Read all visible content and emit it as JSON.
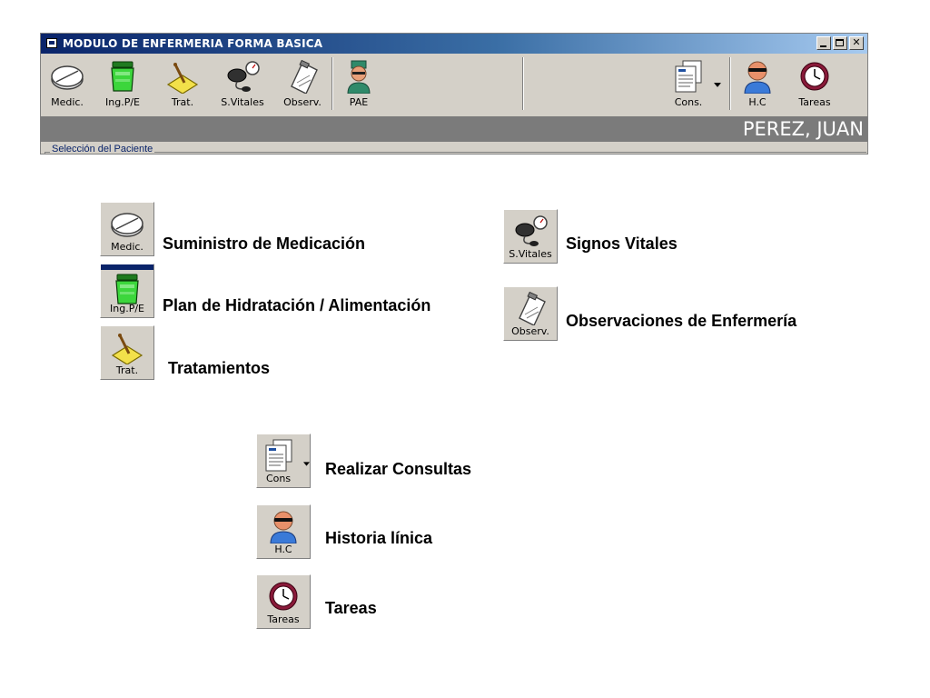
{
  "window": {
    "title": "MODULO DE ENFERMERIA FORMA BASICA",
    "patient_name": "PEREZ, JUAN",
    "group_label": "Selección del Paciente"
  },
  "toolbar": {
    "medic": "Medic.",
    "ingpe": "Ing.P/E",
    "trat": "Trat.",
    "svitales": "S.Vitales",
    "observ": "Observ.",
    "pae": "PAE",
    "cons": "Cons.",
    "hc": "H.C",
    "tareas": "Tareas"
  },
  "legend": {
    "medic": {
      "tile": "Medic.",
      "desc": "Suministro de Medicación"
    },
    "ingpe": {
      "tile": "Ing.P/E",
      "desc": "Plan de Hidratación / Alimentación"
    },
    "trat": {
      "tile": "Trat.",
      "desc": "Tratamientos"
    },
    "svitales": {
      "tile": "S.Vitales",
      "desc": "Signos Vitales"
    },
    "observ": {
      "tile": "Observ.",
      "desc": "Observaciones de Enfermería"
    },
    "cons": {
      "tile": "Cons",
      "desc": "Realizar Consultas"
    },
    "hc": {
      "tile": "H.C",
      "desc": "Historia línica"
    },
    "tareas": {
      "tile": "Tareas",
      "desc": "Tareas"
    }
  },
  "icons": {
    "medic": "pill-icon",
    "ingpe": "fluid-container-icon",
    "trat": "treatment-icon",
    "svitales": "blood-pressure-icon",
    "observ": "clipboard-icon",
    "pae": "nurse-icon",
    "cons": "documents-icon",
    "hc": "patient-icon",
    "tareas": "clock-icon"
  },
  "colors": {
    "titlebar": "#0a246a",
    "window_bg": "#d4d0c8",
    "patient_bar": "#7b7b7b"
  }
}
